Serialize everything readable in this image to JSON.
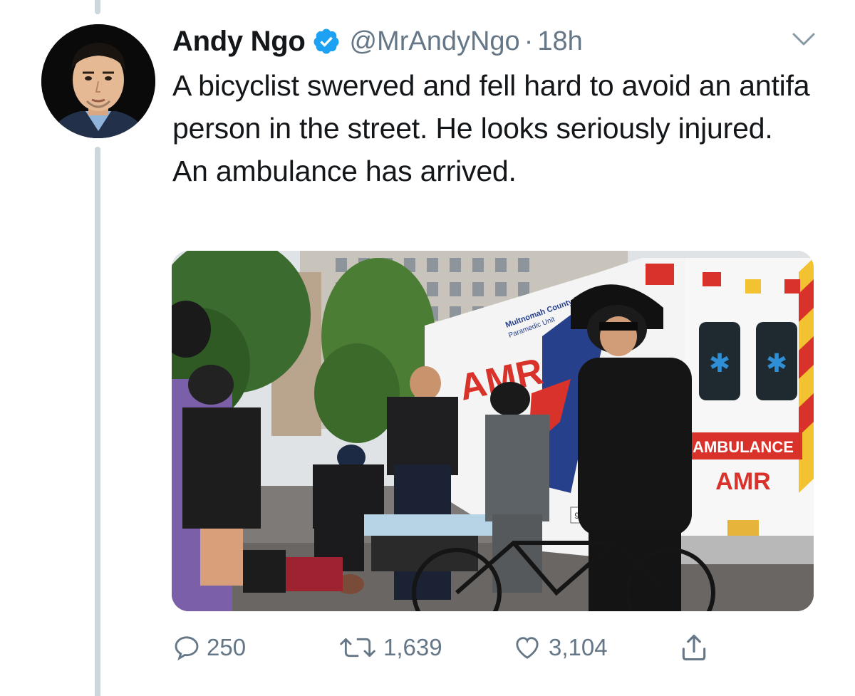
{
  "tweet": {
    "author": {
      "display_name": "Andy Ngo",
      "handle": "@MrAndyNgo",
      "verified": true,
      "avatar_icon": "profile-photo"
    },
    "separator": "·",
    "timestamp": "18h",
    "text": "A bicyclist swerved and fell hard to avoid an antifa person in the street. He looks seriously injured. An ambulance has arrived.",
    "media": {
      "type": "photo",
      "vehicle_text": {
        "agency_line1": "Multnomah County EMS",
        "agency_line2": "Paramedic Unit",
        "side_logo": "AMR",
        "rear_label": "AMBULANCE",
        "rear_logo": "AMR",
        "unit_number": "911"
      }
    },
    "stats": {
      "replies": "250",
      "retweets": "1,639",
      "likes": "3,104"
    }
  },
  "colors": {
    "text_primary": "#14171a",
    "text_secondary": "#657786",
    "verified_blue": "#1da1f2",
    "thread_line": "#ccd6dd"
  },
  "icons": [
    "verified-badge-icon",
    "chevron-down-icon",
    "reply-icon",
    "retweet-icon",
    "like-icon",
    "share-icon"
  ]
}
